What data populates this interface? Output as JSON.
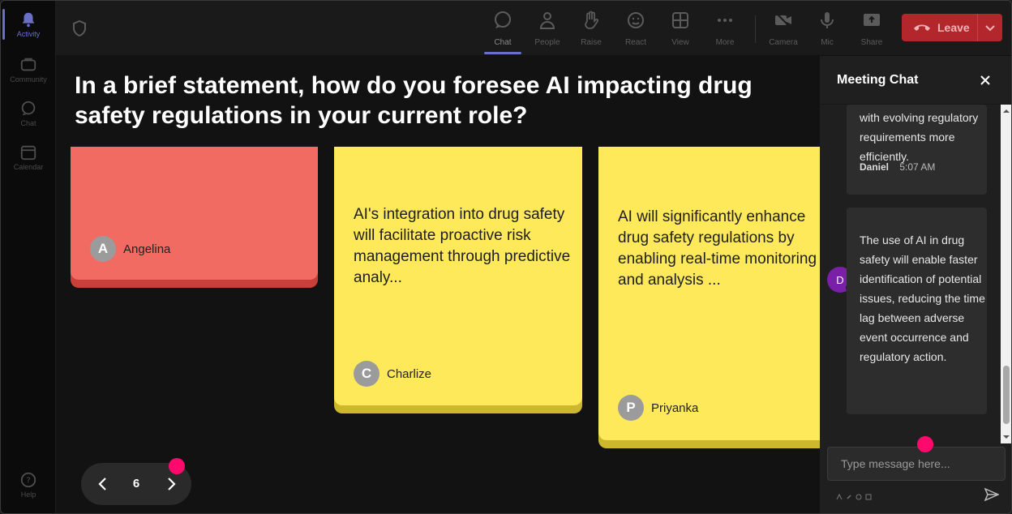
{
  "rail": {
    "items": [
      {
        "label": "Activity",
        "icon": "bell-icon"
      },
      {
        "label": "Community",
        "icon": "community-icon"
      },
      {
        "label": "Chat",
        "icon": "chat-icon"
      },
      {
        "label": "Calendar",
        "icon": "calendar-icon"
      },
      {
        "label": "Help",
        "icon": "help-icon"
      }
    ]
  },
  "toolbar": {
    "chat": "Chat",
    "people": "People",
    "raise": "Raise",
    "react": "React",
    "view": "View",
    "more": "More",
    "camera": "Camera",
    "mic": "Mic",
    "share": "Share",
    "leave": "Leave"
  },
  "question": "In a brief statement, how do you foresee AI impacting drug safety regulations in your current role?",
  "notes": [
    {
      "text": "",
      "author": "Angelina",
      "initial": "A",
      "color": "#f26b63",
      "shadow": "#c9403a"
    },
    {
      "text": "AI's integration into drug safety will facilitate proactive risk management through predictive analy...",
      "author": "Charlize",
      "initial": "C",
      "color": "#fee95a",
      "shadow": "#cdb72c"
    },
    {
      "text": "AI will significantly enhance drug safety regulations by enabling real-time monitoring and analysis ...",
      "author": "Priyanka",
      "initial": "P",
      "color": "#fee95a",
      "shadow": "#cdb72c"
    }
  ],
  "pager": {
    "page": "6"
  },
  "chat": {
    "title": "Meeting Chat",
    "prev_message": "with evolving regulatory requirements more efficiently.",
    "message": {
      "sender": "Daniel",
      "time": "5:07 AM",
      "initial": "D",
      "text": "The use of AI in drug safety will enable faster identification of potential issues, reducing the time lag between adverse event occurrence and regulatory action."
    },
    "input_placeholder": "Type message here..."
  },
  "colors": {
    "accent": "#6a6fc8",
    "leave": "#b3262c",
    "highlight_dot": "#ff0a6c"
  }
}
